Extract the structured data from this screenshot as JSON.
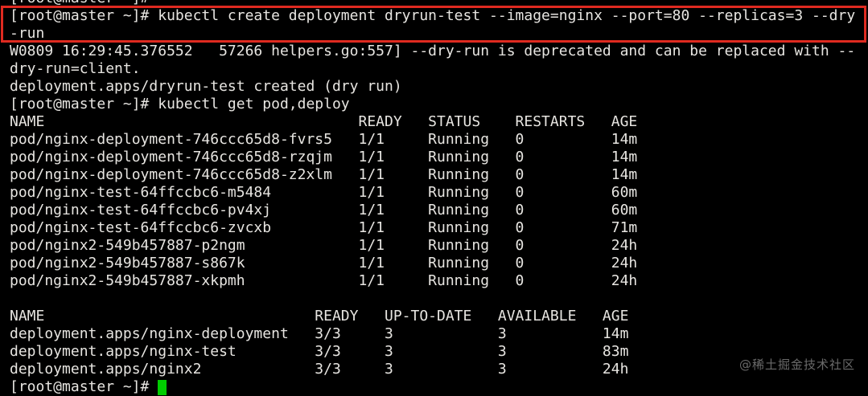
{
  "terminal": {
    "colors": {
      "background": "#000000",
      "text": "#e7e5e1",
      "highlight_border": "#df2a20",
      "cursor": "#00cc00",
      "watermark": "#6a6a6a"
    },
    "previous_prompt": "[root@master ~]#",
    "highlighted_command": {
      "line1": "[root@master ~]# kubectl create deployment dryrun-test --image=nginx --port=80 --replicas=3 --dry",
      "line2": "-run"
    },
    "warning": {
      "line1": "W0809 16:29:45.376552   57266 helpers.go:557] --dry-run is deprecated and can be replaced with --",
      "line2": "dry-run=client."
    },
    "dry_run_result": "deployment.apps/dryrun-test created (dry run)",
    "get_command": "[root@master ~]# kubectl get pod,deploy",
    "pods_table": {
      "col_offsets": [
        0,
        40,
        48,
        58,
        69
      ],
      "headers": [
        "NAME",
        "READY",
        "STATUS",
        "RESTARTS",
        "AGE"
      ],
      "rows": [
        [
          "pod/nginx-deployment-746ccc65d8-fvrs5",
          "1/1",
          "Running",
          "0",
          "14m"
        ],
        [
          "pod/nginx-deployment-746ccc65d8-rzqjm",
          "1/1",
          "Running",
          "0",
          "14m"
        ],
        [
          "pod/nginx-deployment-746ccc65d8-z2xlm",
          "1/1",
          "Running",
          "0",
          "14m"
        ],
        [
          "pod/nginx-test-64ffccbc6-m5484",
          "1/1",
          "Running",
          "0",
          "60m"
        ],
        [
          "pod/nginx-test-64ffccbc6-pv4xj",
          "1/1",
          "Running",
          "0",
          "60m"
        ],
        [
          "pod/nginx-test-64ffccbc6-zvcxb",
          "1/1",
          "Running",
          "0",
          "71m"
        ],
        [
          "pod/nginx2-549b457887-p2ngm",
          "1/1",
          "Running",
          "0",
          "24h"
        ],
        [
          "pod/nginx2-549b457887-s867k",
          "1/1",
          "Running",
          "0",
          "24h"
        ],
        [
          "pod/nginx2-549b457887-xkpmh",
          "1/1",
          "Running",
          "0",
          "24h"
        ]
      ]
    },
    "deployments_table": {
      "col_offsets": [
        0,
        35,
        43,
        56,
        68
      ],
      "headers": [
        "NAME",
        "READY",
        "UP-TO-DATE",
        "AVAILABLE",
        "AGE"
      ],
      "rows": [
        [
          "deployment.apps/nginx-deployment",
          "3/3",
          "3",
          "3",
          "14m"
        ],
        [
          "deployment.apps/nginx-test",
          "3/3",
          "3",
          "3",
          "83m"
        ],
        [
          "deployment.apps/nginx2",
          "3/3",
          "3",
          "3",
          "24h"
        ]
      ]
    },
    "final_prompt": "[root@master ~]#"
  },
  "watermark": "@稀土掘金技术社区"
}
